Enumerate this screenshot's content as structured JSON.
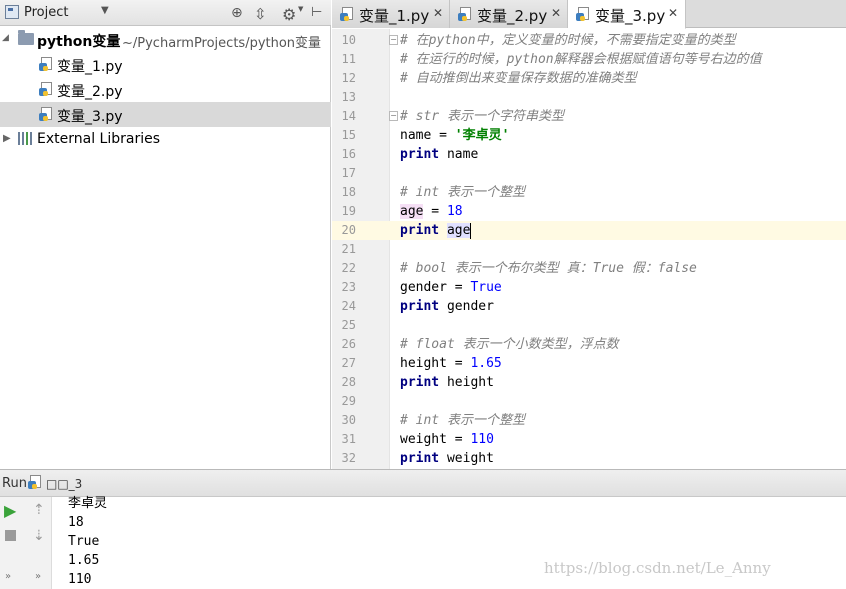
{
  "project_panel": {
    "title": "Project",
    "tree": {
      "root": {
        "label": "python变量",
        "path": "~/PycharmProjects/python变量"
      },
      "files": [
        {
          "label": "变量_1.py"
        },
        {
          "label": "变量_2.py"
        },
        {
          "label": "变量_3.py"
        }
      ],
      "external": {
        "label": "External Libraries"
      }
    }
  },
  "tabs": [
    {
      "label": "变量_1.py"
    },
    {
      "label": "变量_2.py"
    },
    {
      "label": "变量_3.py"
    }
  ],
  "editor": {
    "lines": [
      {
        "n": "10",
        "comment": "# 在python中，定义变量的时候，不需要指定变量的类型"
      },
      {
        "n": "11",
        "comment": "# 在运行的时候，python解释器会根据赋值语句等号右边的值"
      },
      {
        "n": "12",
        "comment": "# 自动推倒出来变量保存数据的准确类型"
      },
      {
        "n": "13"
      },
      {
        "n": "14",
        "comment": "# str 表示一个字符串类型"
      },
      {
        "n": "15",
        "var": "name",
        "op": " = ",
        "str": "'李卓灵'"
      },
      {
        "n": "16",
        "kw": "print",
        "arg": " name"
      },
      {
        "n": "17"
      },
      {
        "n": "18",
        "comment": "# int 表示一个整型"
      },
      {
        "n": "19",
        "var": "age",
        "op": " = ",
        "num": "18"
      },
      {
        "n": "20",
        "kw": "print",
        "arg": "age"
      },
      {
        "n": "21"
      },
      {
        "n": "22",
        "comment": "# bool 表示一个布尔类型 真：True 假：false"
      },
      {
        "n": "23",
        "var": "gender",
        "op": " = ",
        "num": "True"
      },
      {
        "n": "24",
        "kw": "print",
        "arg": " gender"
      },
      {
        "n": "25"
      },
      {
        "n": "26",
        "comment": "# float 表示一个小数类型，浮点数"
      },
      {
        "n": "27",
        "var": "height",
        "op": " = ",
        "num": "1.65"
      },
      {
        "n": "28",
        "kw": "print",
        "arg": " height"
      },
      {
        "n": "29"
      },
      {
        "n": "30",
        "comment": "# int 表示一个整型"
      },
      {
        "n": "31",
        "var": "weight",
        "op": " = ",
        "num": "110"
      },
      {
        "n": "32",
        "kw": "print",
        "arg": " weight"
      }
    ]
  },
  "run": {
    "label": "Run",
    "config_name": "□□_3",
    "output": [
      "李卓灵",
      "18",
      "True",
      "1.65",
      "110"
    ],
    "watermark": "https://blog.csdn.net/Le_Anny"
  },
  "colors": {
    "keyword": "#000080",
    "string": "#008000",
    "number": "#0000ff",
    "comment": "#808080",
    "current_line": "#fffae3"
  },
  "icons": [
    "project-icon",
    "dropdown-icon",
    "target-icon",
    "collapse-icon",
    "gear-icon",
    "hide-icon",
    "folder-icon",
    "python-file-icon",
    "library-icon",
    "close-icon",
    "rerun-icon",
    "stop-icon",
    "up-arrow-icon",
    "down-arrow-icon"
  ]
}
